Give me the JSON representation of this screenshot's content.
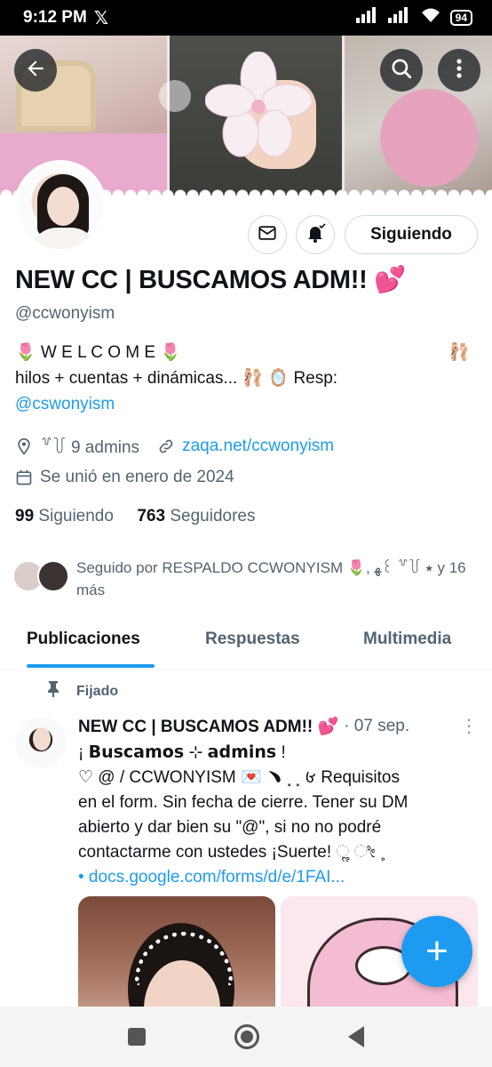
{
  "status_bar": {
    "time": "9:12 PM",
    "x_logo": "𝕏",
    "battery": "94"
  },
  "profile": {
    "name": "NEW CC | BUSCAMOS ADM!! 💕",
    "handle": "@ccwonyism",
    "follow_label": "Siguiendo",
    "bio_line1": "🌷 W E L C O M E 🌷",
    "bio_line1_right": "🩰",
    "bio_line2": "hilos + cuentas + dinámicas... 🩰 🪞 Resp:",
    "bio_link": "@cswonyism",
    "location": "꒷꒦ 9 admins",
    "website": "zaqa.net/ccwonyism",
    "joined": "Se unió en enero de 2024",
    "following_count": "99",
    "following_label": "Siguiendo",
    "followers_count": "763",
    "followers_label": "Seguidores",
    "followed_by": "Seguido por RESPALDO CCWONYISM 🌷, ﻬ꒰ ꒷꒦ ⭑ y 16 más"
  },
  "tabs": [
    {
      "label": "Publicaciones",
      "active": true
    },
    {
      "label": "Respuestas",
      "active": false
    },
    {
      "label": "Multimedia",
      "active": false
    }
  ],
  "post": {
    "pinned_label": "Fijado",
    "author": "NEW CC | BUSCAMOS ADM!! 💕",
    "date": "· 07 sep.",
    "line1": "¡  𝗕𝘂𝘀𝗰𝗮𝗺𝗼𝘀  ⊹  𝗮𝗱𝗺𝗶𝗻𝘀  !",
    "line2": "♡ @ / CCWONYISM 💌 ﹅ ⸼ ⸼ 𑄾 Requisitos",
    "line3": "en el form. Sin fecha de cierre. Tener su DM",
    "line4": "abierto y dar bien su \"@\", si no no podré",
    "line5": "contactarme con ustedes ¡Suerte!  ૢ ೀ ˳",
    "link": "• docs.google.com/forms/d/e/1FAI..."
  },
  "colors": {
    "accent": "#1d9bf0",
    "text": "#0f1419",
    "muted": "#536471"
  },
  "icons": [
    "back-arrow-icon",
    "search-icon",
    "more-vertical-icon",
    "mail-icon",
    "bell-icon",
    "location-icon",
    "link-icon",
    "calendar-icon",
    "pin-icon",
    "plus-icon"
  ]
}
